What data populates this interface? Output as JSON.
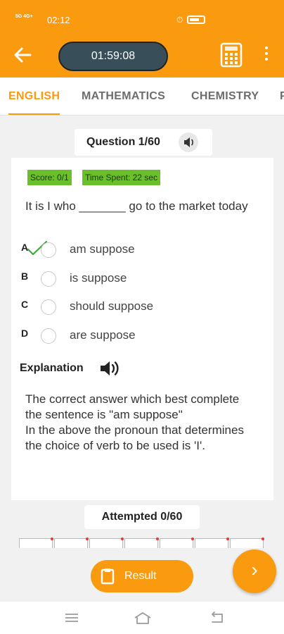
{
  "status": {
    "signal_text": "5G 4G+",
    "time": "02:12",
    "alarm_icon": "alarm-icon",
    "battery_icon": "battery-icon"
  },
  "header": {
    "back_icon": "back-arrow-icon",
    "timer": "01:59:08",
    "calculator_icon": "calculator-icon",
    "more_icon": "more-vertical-icon",
    "accent": "#fa9a0f",
    "timer_bg": "#384f5a"
  },
  "tabs": [
    {
      "label": "ENGLISH",
      "active": true
    },
    {
      "label": "MATHEMATICS",
      "active": false
    },
    {
      "label": "CHEMISTRY",
      "active": false
    },
    {
      "label": "P",
      "active": false
    }
  ],
  "question": {
    "header": "Question 1/60",
    "speaker_icon": "speaker-icon",
    "score": "Score: 0/1",
    "time_spent": "Time Spent: 22 sec",
    "text": "It is I who _______ go to the market today",
    "options": [
      {
        "letter": "A",
        "text": "am suppose",
        "correct": true
      },
      {
        "letter": "B",
        "text": "is suppose",
        "correct": false
      },
      {
        "letter": "C",
        "text": "should suppose",
        "correct": false
      },
      {
        "letter": "D",
        "text": "are suppose",
        "correct": false
      }
    ]
  },
  "explanation": {
    "heading": "Explanation",
    "speaker_icon": "speaker-icon",
    "body_line1": "The correct answer which best complete the sentence is \"am suppose\"",
    "body_line2": "In the above the pronoun that determines the choice of verb to be used is 'I'."
  },
  "attempted": "Attempted 0/60",
  "result_button": "Result",
  "next_icon": "chevron-right-icon",
  "navbar": {
    "menu_icon": "menu-icon",
    "home_icon": "home-icon",
    "back_icon": "back-icon"
  }
}
